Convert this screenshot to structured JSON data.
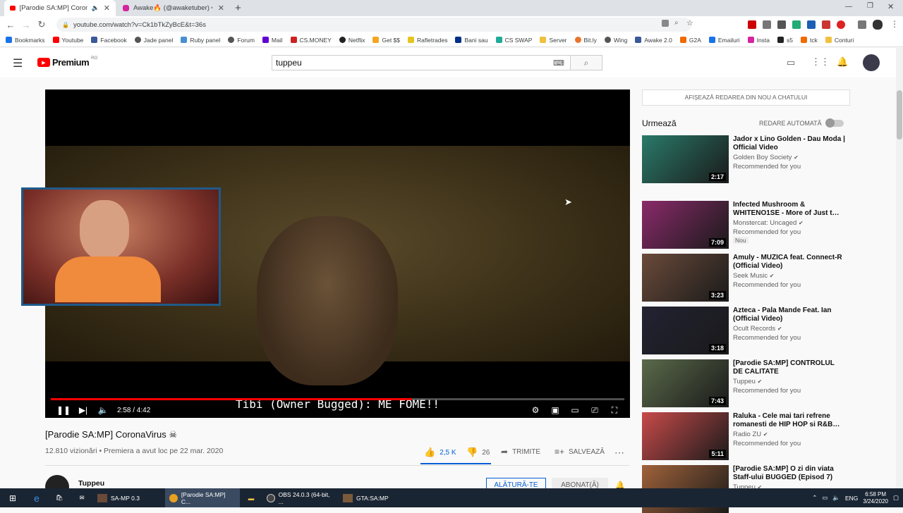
{
  "browser": {
    "tabs": [
      {
        "title": "[Parodie SA:MP] CoronaVirus",
        "active": true
      },
      {
        "title": "Awake🔥 (@awaketuber) • Fotog",
        "active": false
      }
    ],
    "url": "youtube.com/watch?v=Ck1bTkZyBcE&t=36s",
    "bookmarks": [
      "Bookmarks",
      "Youtube",
      "Facebook",
      "Jade panel",
      "Ruby panel",
      "Forum",
      "Mail",
      "CS.MONEY",
      "Netflix",
      "Get $$",
      "Rafletrades",
      "Bani sau",
      "CS SWAP",
      "Server",
      "Bit.ly",
      "Wing",
      "Awake 2.0",
      "G2A",
      "Emailuri",
      "Insta",
      "s5",
      "tck",
      "Conturi"
    ]
  },
  "youtube": {
    "logo": "Premium",
    "region": "RO",
    "search_value": "tuppeu"
  },
  "player": {
    "caption": "Tibi (Owner Bugged): ME FOME!!",
    "time": "2:58 / 4:42",
    "progress": 0.63
  },
  "video": {
    "title": "[Parodie SA:MP] CoronaVirus ☠",
    "meta": "12.810 vizionări • Premiera a avut loc pe 22 mar. 2020",
    "likes": "2,5 K",
    "dislikes": "26",
    "share": "TRIMITE",
    "save": "SALVEAZĂ",
    "channel": "Tuppeu",
    "join": "ALĂTURĂ-TE",
    "subscribed": "ABONAT(Ă)"
  },
  "sidebar": {
    "chat_button": "AFIȘEAZĂ REDAREA DIN NOU A CHATULUI",
    "up_next": "Urmează",
    "autoplay": "REDARE AUTOMATĂ",
    "recommendations": [
      {
        "title": "Jador x Lino Golden - Dau Moda | Official Video",
        "channel": "Golden Boy Society",
        "sub": "Recommended for you",
        "duration": "2:17",
        "color": "#2a7a6a"
      },
      {
        "title": "Infected Mushroom & WHITENO1SE - More of Just t…",
        "channel": "Monstercat: Uncaged",
        "sub": "Recommended for you",
        "badge": "Nou",
        "duration": "7:09",
        "color": "#8a2a6a"
      },
      {
        "title": "Amuly - MUZICA feat. Connect-R (Official Video)",
        "channel": "Seek Music",
        "sub": "Recommended for you",
        "duration": "3:23",
        "color": "#6a4a3a"
      },
      {
        "title": "Azteca - Pala Mande Feat. Ian (Official Video)",
        "channel": "Ocult Records",
        "sub": "Recommended for you",
        "duration": "3:18",
        "color": "#222233"
      },
      {
        "title": "[Parodie SA:MP] CONTROLUL DE CALITATE",
        "channel": "Tuppeu",
        "sub": "Recommended for you",
        "duration": "7:43",
        "color": "#5a6a4a"
      },
      {
        "title": "Raluka - Cele mai tari refrene romanesti de HIP HOP si R&B…",
        "channel": "Radio ZU",
        "sub": "Recommended for you",
        "duration": "5:11",
        "color": "#c84a4a"
      },
      {
        "title": "[Parodie SA:MP] O zi din viata Staff-ului BUGGED (Episod 7)",
        "channel": "Tuppeu",
        "sub": "",
        "duration": "",
        "color": "#a0623a"
      }
    ]
  },
  "taskbar": {
    "apps": [
      "SA-MP 0.3",
      "[Parodie SA:MP] C...",
      "OBS 24.0.3 (64-bit, ...",
      "GTA:SA:MP"
    ],
    "lang": "ENG",
    "time": "6:58 PM",
    "date": "3/24/2020"
  }
}
